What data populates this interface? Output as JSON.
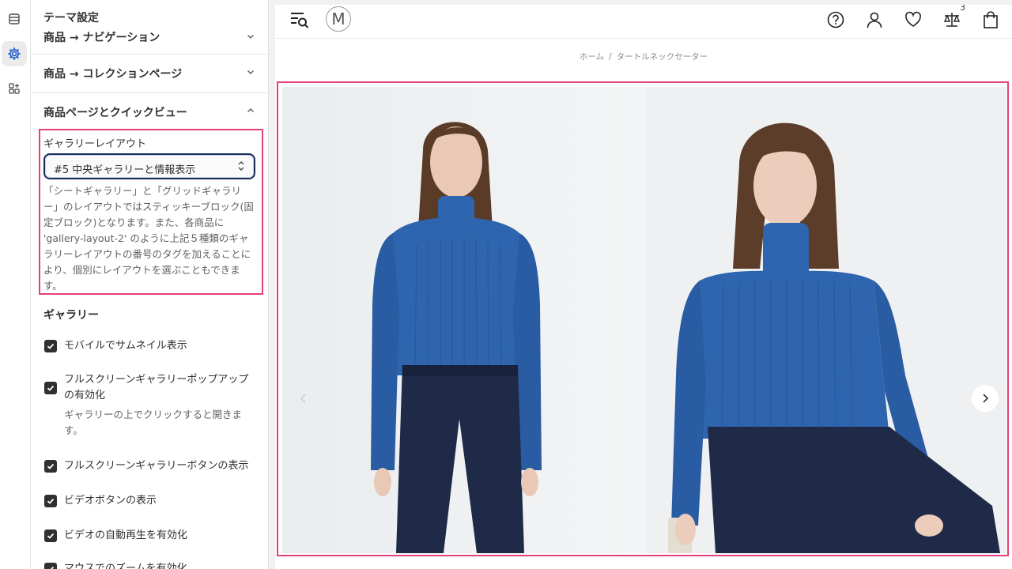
{
  "panel": {
    "title": "テーマ設定",
    "partial_section": "商品 → ナビゲーション",
    "collection_section": "商品 → コレクションページ",
    "product_section": "商品ページとクイックビュー",
    "gallery_layout": {
      "label": "ギャラリーレイアウト",
      "selected": "#5 中央ギャラリーと情報表示",
      "help": "「シートギャラリー」と「グリッドギャラリー」のレイアウトではスティッキーブロック(固定ブロック)となります。また、各商品に 'gallery-layout-2' のように上記５種類のギャラリーレイアウトの番号のタグを加えることにより、個別にレイアウトを選ぶこともできます。"
    },
    "gallery_group": {
      "title": "ギャラリー",
      "options": [
        {
          "label": "モバイルでサムネイル表示",
          "checked": true
        },
        {
          "label": "フルスクリーンギャラリーポップアップの有効化",
          "checked": true,
          "sub": "ギャラリーの上でクリックすると開きます。"
        },
        {
          "label": "フルスクリーンギャラリーボタンの表示",
          "checked": true
        },
        {
          "label": "ビデオボタンの表示",
          "checked": true
        },
        {
          "label": "ビデオの自動再生を有効化",
          "checked": true
        },
        {
          "label": "マウスでのズームを有効化",
          "checked": true
        }
      ]
    }
  },
  "preview": {
    "logo": "M",
    "compare_count": "3",
    "breadcrumb": {
      "home": "ホーム",
      "sep": "/",
      "current": "タートルネックセーター"
    }
  },
  "colors": {
    "highlight": "#e4407a",
    "sweater": "#2f64ae",
    "trousers": "#1e2a48"
  }
}
